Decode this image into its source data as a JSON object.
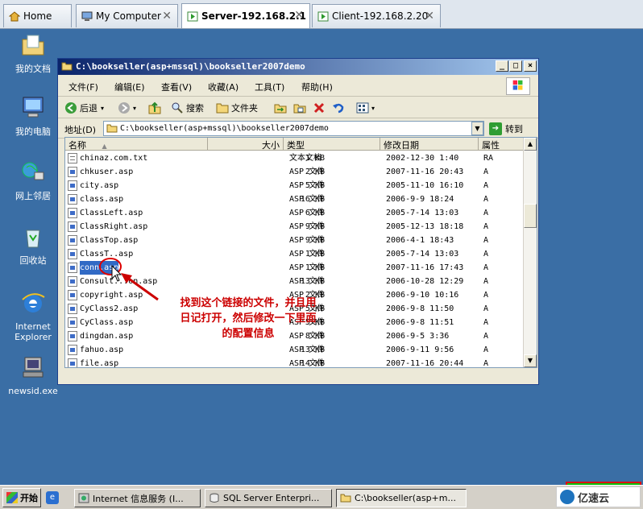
{
  "tabs": [
    {
      "label": "Home",
      "icon": "home-icon",
      "closable": false
    },
    {
      "label": "My Computer",
      "icon": "computer-icon",
      "closable": true
    },
    {
      "label": "Server-192.168.2.1",
      "icon": "vm-running-icon",
      "closable": true,
      "active": true
    },
    {
      "label": "Client-192.168.2.20",
      "icon": "vm-running-icon",
      "closable": true
    }
  ],
  "close_glyph": "✕",
  "desktop_icons": [
    {
      "label": "我的文档",
      "icon": "my-documents-icon"
    },
    {
      "label": "我的电脑",
      "icon": "my-computer-icon"
    },
    {
      "label": "网上邻居",
      "icon": "network-places-icon"
    },
    {
      "label": "回收站",
      "icon": "recycle-bin-icon"
    },
    {
      "label": "Internet Explorer",
      "icon": "internet-explorer-icon"
    },
    {
      "label": "newsid.exe",
      "icon": "newsid-exe-icon"
    }
  ],
  "window": {
    "title": "C:\\bookseller(asp+mssql)\\bookseller2007demo",
    "minimize": "_",
    "maximize": "□",
    "close": "×",
    "menu": [
      "文件(F)",
      "编辑(E)",
      "查看(V)",
      "收藏(A)",
      "工具(T)",
      "帮助(H)"
    ],
    "toolbar": {
      "back": "后退",
      "search": "搜索",
      "folders": "文件夹"
    },
    "address": {
      "label": "地址(D)",
      "value": "C:\\bookseller(asp+mssql)\\bookseller2007demo",
      "go": "转到"
    },
    "columns": [
      "名称",
      "大小",
      "类型",
      "修改日期",
      "属性"
    ],
    "files": [
      {
        "name": "chinaz.com.txt",
        "size": "1 KB",
        "type": "文本文档",
        "modified": "2002-12-30 1:40",
        "attr": "RA",
        "kind": "txt"
      },
      {
        "name": "chkuser.asp",
        "size": "2 KB",
        "type": "ASP 文件",
        "modified": "2007-11-16 20:43",
        "attr": "A",
        "kind": "asp"
      },
      {
        "name": "city.asp",
        "size": "5 KB",
        "type": "ASP 文件",
        "modified": "2005-11-10 16:10",
        "attr": "A",
        "kind": "asp"
      },
      {
        "name": "class.asp",
        "size": "16 KB",
        "type": "ASP 文件",
        "modified": "2006-9-9 18:24",
        "attr": "A",
        "kind": "asp"
      },
      {
        "name": "ClassLeft.asp",
        "size": "6 KB",
        "type": "ASP 文件",
        "modified": "2005-7-14 13:03",
        "attr": "A",
        "kind": "asp"
      },
      {
        "name": "ClassRight.asp",
        "size": "9 KB",
        "type": "ASP 文件",
        "modified": "2005-12-13 18:18",
        "attr": "A",
        "kind": "asp"
      },
      {
        "name": "ClassTop.asp",
        "size": "9 KB",
        "type": "ASP 文件",
        "modified": "2006-4-1 18:43",
        "attr": "A",
        "kind": "asp"
      },
      {
        "name": "ClassT..asp",
        "size": "1 KB",
        "type": "ASP 文件",
        "modified": "2005-7-14 13:03",
        "attr": "A",
        "kind": "asp"
      },
      {
        "name": "conn.asp",
        "size": "1 KB",
        "type": "ASP 文件",
        "modified": "2007-11-16 17:43",
        "attr": "A",
        "kind": "asp",
        "selected": true
      },
      {
        "name": "Consult...on.asp",
        "size": "13 KB",
        "type": "ASP 文件",
        "modified": "2006-10-28 12:29",
        "attr": "A",
        "kind": "asp"
      },
      {
        "name": "copyright.asp",
        "size": "2 KB",
        "type": "ASP 文件",
        "modified": "2006-9-10 10:16",
        "attr": "A",
        "kind": "asp"
      },
      {
        "name": "CyClass2.asp",
        "size": "5 KB",
        "type": "ASP 文件",
        "modified": "2006-9-8 11:50",
        "attr": "A",
        "kind": "asp"
      },
      {
        "name": "CyClass.asp",
        "size": "5 KB",
        "type": "ASP 文件",
        "modified": "2006-9-8 11:51",
        "attr": "A",
        "kind": "asp"
      },
      {
        "name": "dingdan.asp",
        "size": "8 KB",
        "type": "ASP 文件",
        "modified": "2006-9-5 3:36",
        "attr": "A",
        "kind": "asp"
      },
      {
        "name": "fahuo.asp",
        "size": "13 KB",
        "type": "ASP 文件",
        "modified": "2006-9-11 9:56",
        "attr": "A",
        "kind": "asp"
      },
      {
        "name": "file.asp",
        "size": "14 KB",
        "type": "ASP 文件",
        "modified": "2007-11-16 20:44",
        "attr": "A",
        "kind": "asp"
      }
    ]
  },
  "annotation": {
    "lines": [
      "找到这个链接的文件，并且用",
      "日记打开，然后修改一下里面",
      "的配置信息"
    ],
    "color": "#cc0000"
  },
  "taskbar": {
    "start": "开始",
    "tasks": [
      {
        "label": "Internet 信息服务 (I...",
        "icon": "iis-icon"
      },
      {
        "label": "SQL Server Enterpri...",
        "icon": "sql-server-icon"
      },
      {
        "label": "C:\\bookseller(asp+m...",
        "icon": "folder-icon",
        "active": true
      }
    ]
  },
  "watermark": "亿速云",
  "colors": {
    "desktop": "#3a6ea5",
    "selection": "#316ac5",
    "title_start": "#0a246a",
    "title_end": "#a6caf0"
  }
}
